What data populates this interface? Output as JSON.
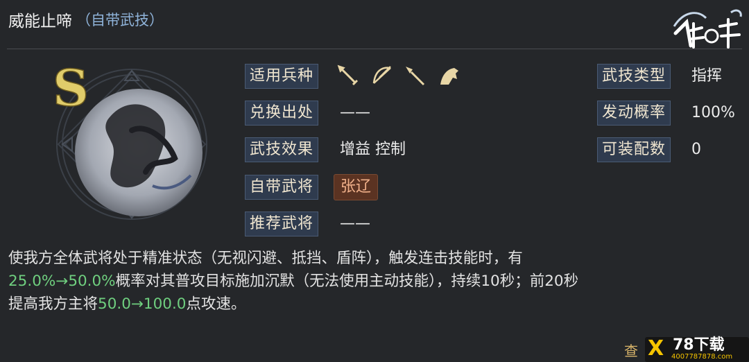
{
  "header": {
    "skill_name": "威能止啼",
    "skill_subtype": "（自带武技）",
    "logo_icon": "game-logo-calligraphy"
  },
  "grade": {
    "letter": "S",
    "color": "#e0cc6a"
  },
  "fields_left": {
    "troop_label": "适用兵种",
    "troop_icons": [
      "sword-icon",
      "bow-icon",
      "spear-icon",
      "horse-icon"
    ],
    "exchange_label": "兑换出处",
    "exchange_value": "——",
    "effect_label": "武技效果",
    "effect_value": "增益 控制",
    "general_label": "自带武将",
    "general_value": "张辽",
    "recommend_label": "推荐武将",
    "recommend_value": "——"
  },
  "fields_right": {
    "type_label": "武技类型",
    "type_value": "指挥",
    "chance_label": "发动概率",
    "chance_value": "100%",
    "equip_label": "可装配数",
    "equip_value": "0"
  },
  "description": {
    "line1": "使我方全体武将处于精准状态（无视闪避、抵挡、盾阵），触发连击技能时，有",
    "line2_highlight": "25.0%→50.0%",
    "line2_rest": "概率对其普攻目标施加沉默（无法使用主动技能），持续10秒；前20秒",
    "line3_pre": "提高我方主将",
    "line3_highlight": "50.0→100.0",
    "line3_post": "点攻速。"
  },
  "footer": {
    "detail_text": "查",
    "watermark_main": "78下载",
    "watermark_sub": "4007787878.com"
  },
  "colors": {
    "highlight": "#6fcf7f",
    "label_bg": "#2f3b4e",
    "badge_bg": "#5b3322",
    "background": "#25272a"
  }
}
